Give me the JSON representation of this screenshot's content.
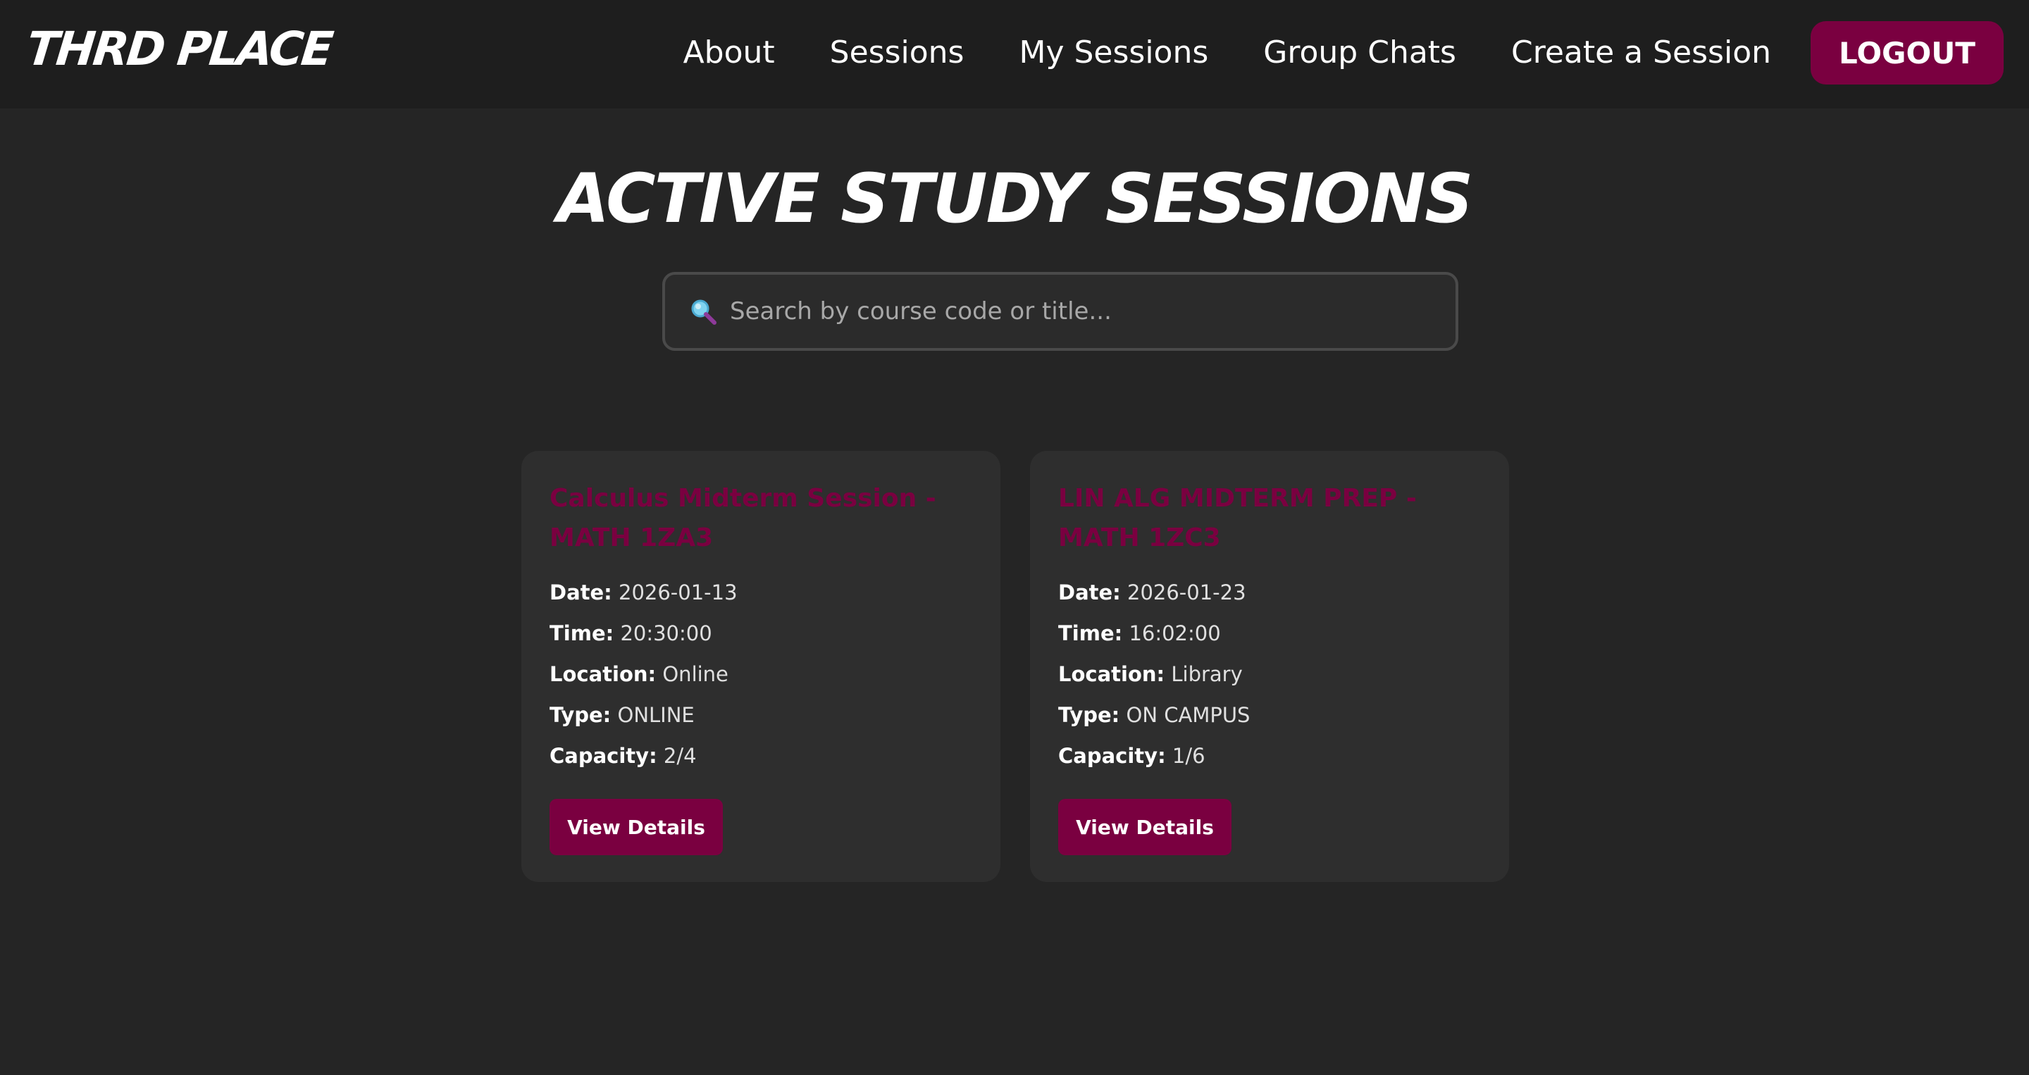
{
  "brand": {
    "name": "THRD PLACE"
  },
  "nav": {
    "links": [
      "About",
      "Sessions",
      "My Sessions",
      "Group Chats",
      "Create a Session"
    ],
    "logout_label": "LOGOUT"
  },
  "main": {
    "title": "ACTIVE STUDY SESSIONS",
    "search": {
      "placeholder": "Search by course code or title...",
      "value": "",
      "icon": "search-icon"
    }
  },
  "labels": {
    "date": "Date:",
    "time": "Time:",
    "location": "Location:",
    "type": "Type:",
    "capacity": "Capacity:"
  },
  "sessions": [
    {
      "title": "Calculus Midterm Session - MATH 1ZA3",
      "date": "2026-01-13",
      "time": "20:30:00",
      "location": "Online",
      "type": "ONLINE",
      "capacity": "2/4",
      "button_label": "View Details"
    },
    {
      "title": "LIN ALG MIDTERM PREP - MATH 1ZC3",
      "date": "2026-01-23",
      "time": "16:02:00",
      "location": "Library",
      "type": "ON CAMPUS",
      "capacity": "1/6",
      "button_label": "View Details"
    }
  ],
  "colors": {
    "accent": "#7a0040",
    "background": "#252525",
    "navbar": "#1e1e1e",
    "card": "#2e2e2e"
  }
}
